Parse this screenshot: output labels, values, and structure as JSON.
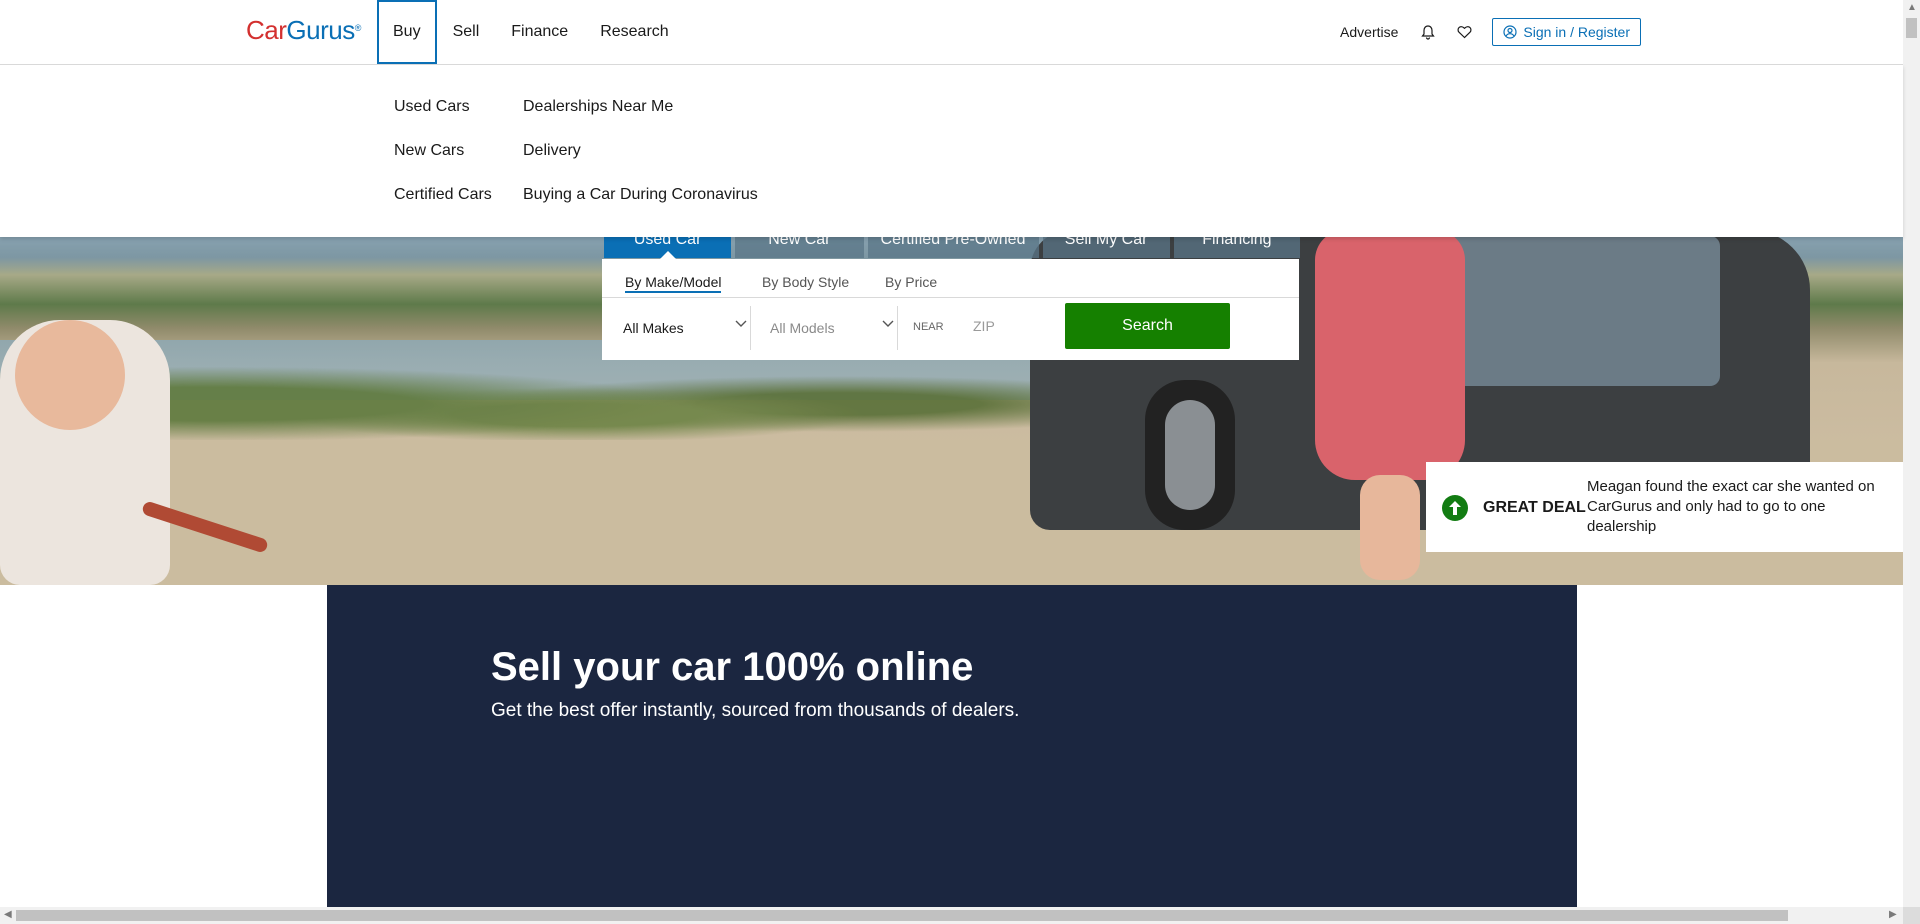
{
  "header": {
    "logo_car": "Car",
    "logo_gurus": "Gurus",
    "logo_mark": "®",
    "nav": [
      {
        "label": "Buy"
      },
      {
        "label": "Sell"
      },
      {
        "label": "Finance"
      },
      {
        "label": "Research"
      }
    ],
    "advertise": "Advertise",
    "signin": "Sign in / Register"
  },
  "dropdown": {
    "col1": [
      "Used Cars",
      "New Cars",
      "Certified Cars"
    ],
    "col2": [
      "Dealerships Near Me",
      "Delivery",
      "Buying a Car During Coronavirus"
    ]
  },
  "search": {
    "tabs": [
      "Used Car",
      "New Car",
      "Certified Pre-Owned",
      "Sell My Car",
      "Financing"
    ],
    "subtabs": [
      "By Make/Model",
      "By Body Style",
      "By Price"
    ],
    "make": "All Makes",
    "model": "All Models",
    "near_label": "NEAR",
    "zip_placeholder": "ZIP",
    "button": "Search"
  },
  "testimonial": {
    "label": "GREAT DEAL",
    "text": "Meagan found the exact car she wanted on CarGurus and only had to go to one dealership"
  },
  "sell": {
    "title": "Sell your car 100% online",
    "subtitle": "Get the best offer instantly, sourced from thousands of dealers."
  },
  "colors": {
    "brand_blue": "#0a6fb5",
    "brand_red": "#d3302f",
    "search_green": "#158000",
    "sell_bg": "#1b2640"
  }
}
